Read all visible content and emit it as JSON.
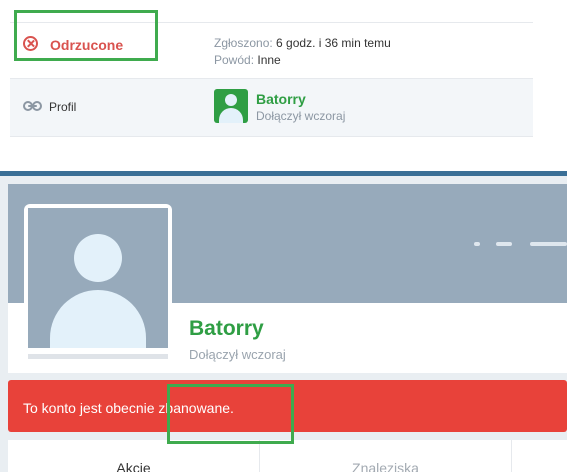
{
  "report": {
    "status": {
      "label": "Odrzucone",
      "icon": "circle-x-icon",
      "color": "#d9534f"
    },
    "reported_label": "Zgłoszono:",
    "reported_value": "6 godz. i 36 min temu",
    "reason_label": "Powód:",
    "reason_value": "Inne",
    "profile_label": "Profil",
    "user": {
      "name": "Batorry",
      "joined": "Dołączył wczoraj"
    }
  },
  "profile": {
    "name": "Batorry",
    "joined": "Dołączył wczoraj",
    "ban_message_prefix": "To konto jest obecnie ",
    "ban_message_highlight": "zbanowane."
  },
  "tabs": [
    "Akcje",
    "Znaleziska"
  ],
  "colors": {
    "accent_green": "#2f9e44",
    "danger_red": "#e8423a",
    "cover": "#97aabb",
    "highlight_box": "#3fab4e"
  }
}
